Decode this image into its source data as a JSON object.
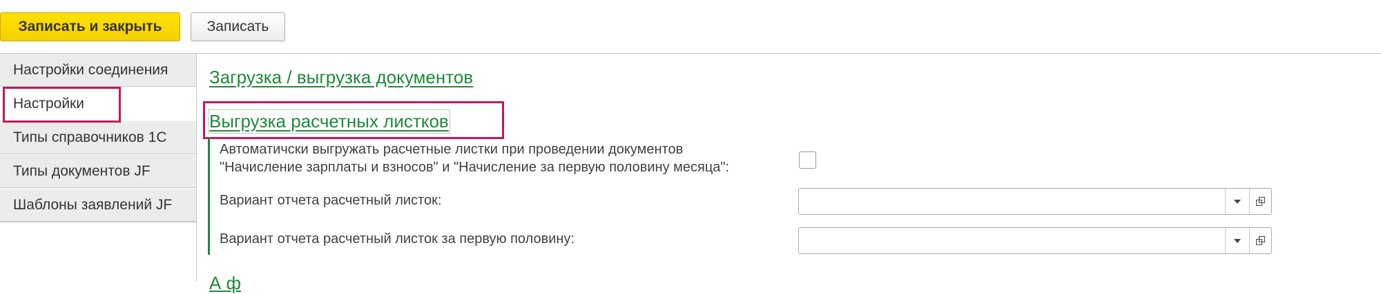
{
  "toolbar": {
    "save_close_label": "Записать и закрыть",
    "save_label": "Записать"
  },
  "tabs": [
    {
      "label": "Настройки соединения",
      "active": false
    },
    {
      "label": "Настройки",
      "active": true
    },
    {
      "label": "Типы справочников 1С",
      "active": false
    },
    {
      "label": "Типы документов JF",
      "active": false
    },
    {
      "label": "Шаблоны заявлений JF",
      "active": false
    }
  ],
  "content": {
    "group1_title": "Загрузка / выгрузка документов",
    "group2_title": "Выгрузка расчетных листков",
    "auto_export_label_line1": "Автоматичски выгружать расчетные листки при проведении документов",
    "auto_export_label_line2": "\"Начисление зарплаты и взносов\" и \"Начисление за первую половину месяца\":",
    "auto_export_checked": false,
    "report_variant_label": "Вариант отчета расчетный листок:",
    "report_variant_value": "",
    "report_variant_half_label": "Вариант отчета расчетный листок за первую половину:",
    "report_variant_half_value": "",
    "group3_title_partial": "А                    ф"
  },
  "colors": {
    "accent_yellow": "#ffe100",
    "link_green": "#1c8a3a",
    "highlight_frame": "#c2185b"
  },
  "icons": {
    "dropdown": "chevron-down-icon",
    "open": "open-form-icon"
  }
}
